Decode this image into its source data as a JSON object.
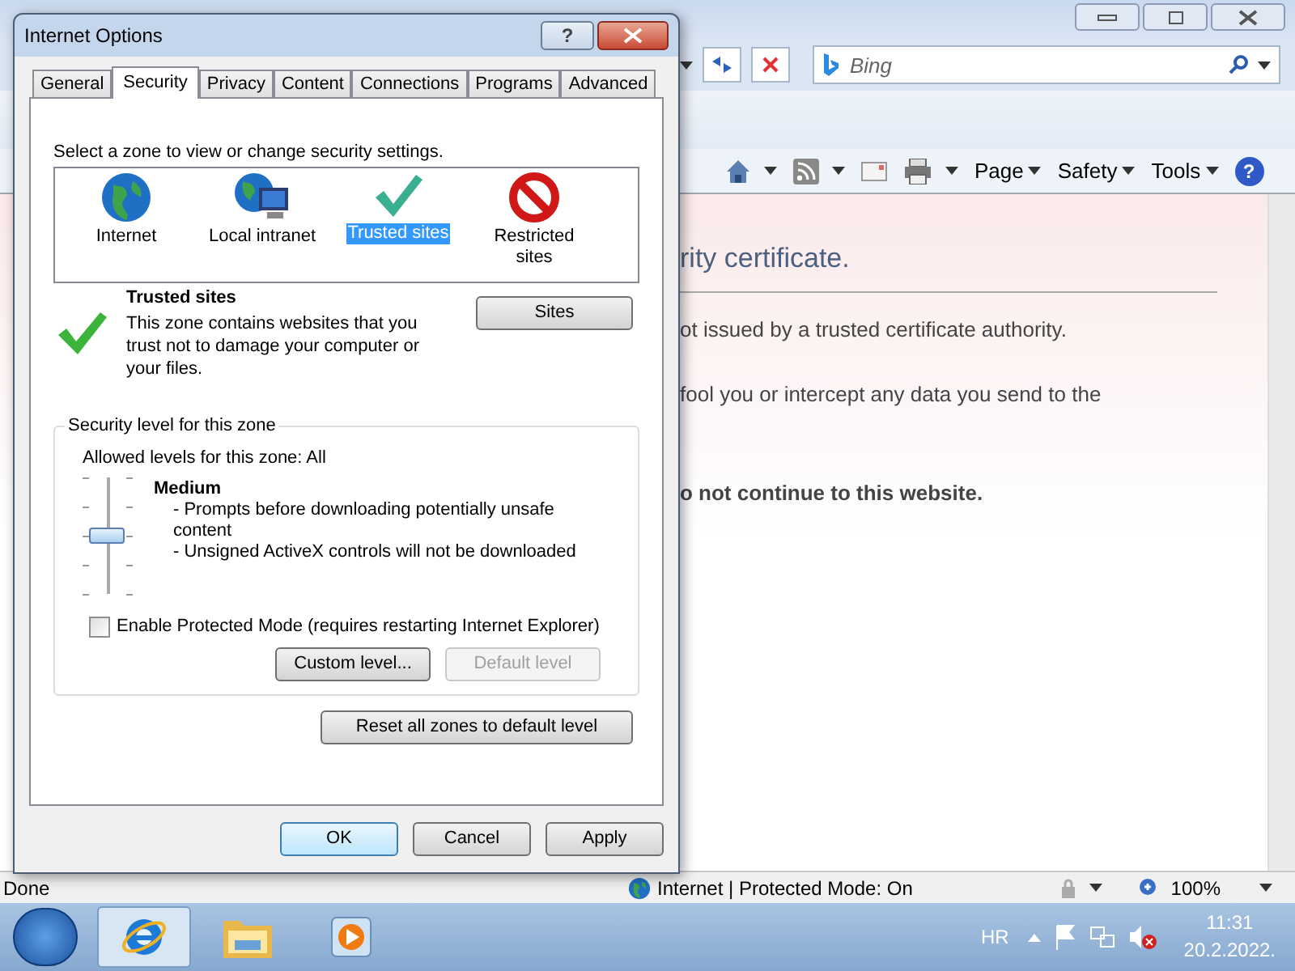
{
  "browser": {
    "search": {
      "placeholder": "Bing"
    },
    "commands": [
      {
        "kind": "home"
      },
      {
        "kind": "feeds"
      },
      {
        "kind": "mail"
      },
      {
        "kind": "print"
      },
      {
        "kind": "menu",
        "label": "Page"
      },
      {
        "kind": "menu",
        "label": "Safety"
      },
      {
        "kind": "menu",
        "label": "Tools"
      },
      {
        "kind": "help",
        "label": "?"
      }
    ],
    "page": {
      "heading": "rity certificate.",
      "lines": [
        "ot issued by a trusted certificate authority.",
        "fool you or intercept any data you send to the"
      ],
      "recommendation": "o not continue to this website."
    },
    "status_bar": {
      "status": "Done",
      "zone": "Internet | Protected Mode: On",
      "zoom": "100%"
    }
  },
  "dialog": {
    "title": "Internet Options",
    "help": "?",
    "tabs": [
      {
        "label": "General",
        "selected": false
      },
      {
        "label": "Security",
        "selected": true
      },
      {
        "label": "Privacy",
        "selected": false
      },
      {
        "label": "Content",
        "selected": false
      },
      {
        "label": "Connections",
        "selected": false
      },
      {
        "label": "Programs",
        "selected": false
      },
      {
        "label": "Advanced",
        "selected": false
      }
    ],
    "zone_prompt": "Select a zone to view or change security settings.",
    "zones": [
      {
        "kind": "internet",
        "label": "Internet",
        "selected": false
      },
      {
        "kind": "intranet",
        "label": "Local intranet",
        "selected": false
      },
      {
        "kind": "trusted",
        "label": "Trusted sites",
        "selected": true
      },
      {
        "kind": "restricted",
        "label": "Restricted sites",
        "selected": false
      }
    ],
    "zone_info": {
      "title": "Trusted sites",
      "description": "This zone contains websites that you trust not to damage your computer or your files.",
      "button": "Sites"
    },
    "security_level": {
      "legend": "Security level for this zone",
      "allowed": "Allowed levels for this zone: All",
      "level": 0.5,
      "name": "Medium",
      "details": [
        "- Prompts before downloading potentially unsafe content",
        "- Unsigned ActiveX controls will not be downloaded"
      ],
      "protected_mode": {
        "label": "Enable Protected Mode (requires restarting Internet Explorer)",
        "checked": false
      },
      "buttons": [
        {
          "label": "Custom level...",
          "disabled": false
        },
        {
          "label": "Default level",
          "disabled": true
        }
      ]
    },
    "reset_button": "Reset all zones to default level",
    "buttons": [
      {
        "label": "OK",
        "default": true
      },
      {
        "label": "Cancel",
        "default": false
      },
      {
        "label": "Apply",
        "default": false
      }
    ]
  },
  "taskbar": {
    "language": "HR",
    "time": "11:31",
    "date": "20.2.2022.",
    "apps": [
      {
        "kind": "browser",
        "active": true
      },
      {
        "kind": "folder",
        "active": false
      },
      {
        "kind": "media",
        "active": false
      }
    ]
  }
}
